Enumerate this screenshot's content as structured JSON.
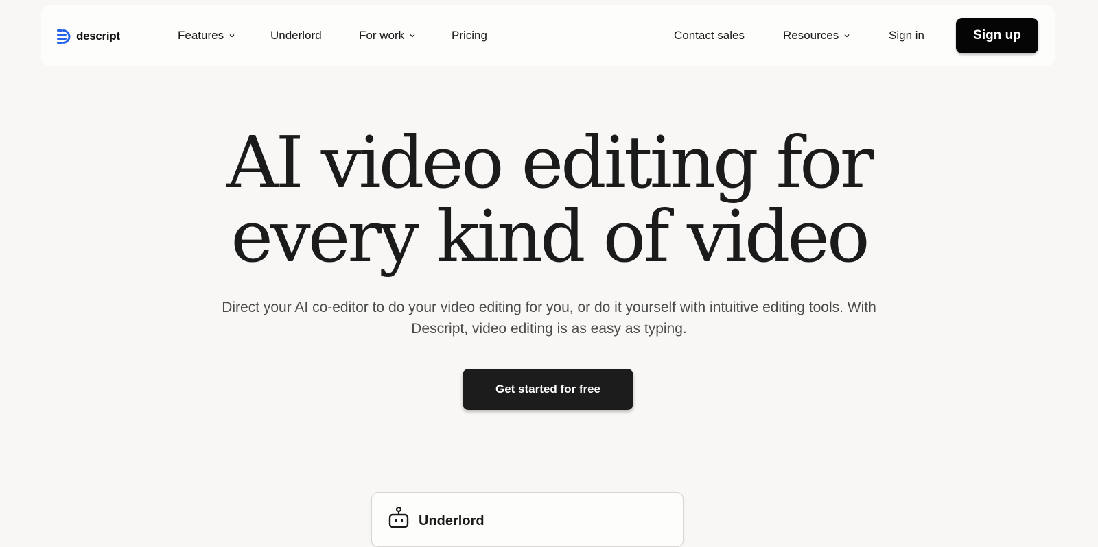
{
  "brand": {
    "name": "descript",
    "accent_color": "#2563eb",
    "icon": "descript-logo-icon"
  },
  "nav": {
    "left": [
      {
        "label": "Features",
        "dropdown": true
      },
      {
        "label": "Underlord",
        "dropdown": false
      },
      {
        "label": "For work",
        "dropdown": true
      },
      {
        "label": "Pricing",
        "dropdown": false
      }
    ],
    "right": [
      {
        "label": "Contact sales",
        "dropdown": false
      },
      {
        "label": "Resources",
        "dropdown": true
      },
      {
        "label": "Sign in",
        "dropdown": false
      }
    ],
    "signup_label": "Sign up"
  },
  "hero": {
    "title_line1": "AI video editing for",
    "title_line2": "every kind of video",
    "subtitle": "Direct your AI co-editor to do your video editing for you, or do it yourself with intuitive editing tools. With Descript, video editing is as easy as typing.",
    "cta_label": "Get started for free"
  },
  "preview_card": {
    "icon": "robot-icon",
    "title": "Underlord"
  }
}
